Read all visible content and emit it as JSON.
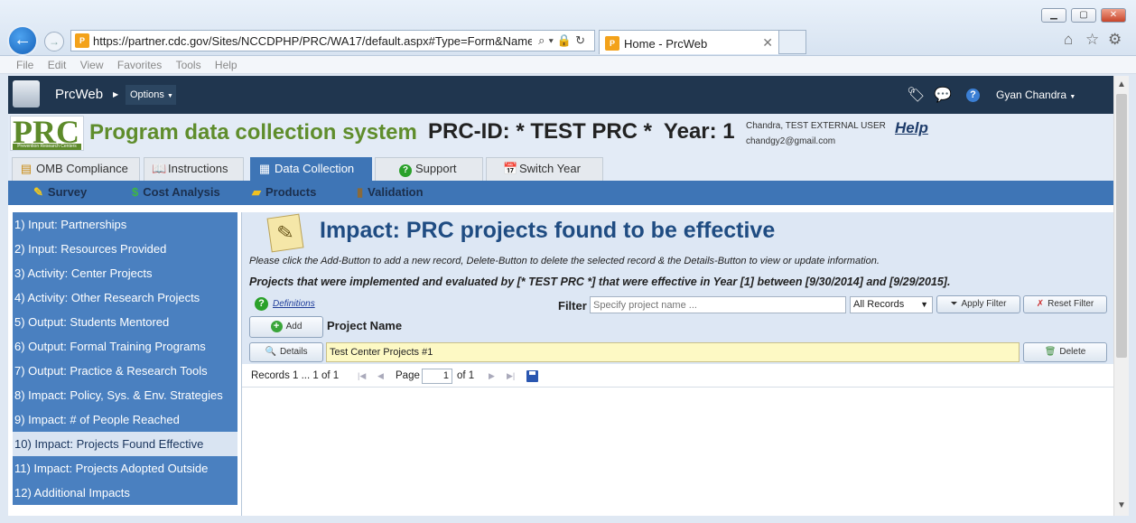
{
  "browser": {
    "url": "https://partner.cdc.gov/Sites/NCCDPHP/PRC/WA17/default.aspx#Type=Form&Name=fCyc",
    "tab_title": "Home - PrcWeb",
    "menu": [
      "File",
      "Edit",
      "View",
      "Favorites",
      "Tools",
      "Help"
    ]
  },
  "appbar": {
    "app_name": "PrcWeb",
    "options_label": "Options",
    "user_name": "Gyan Chandra"
  },
  "banner": {
    "logo_text": "PRC",
    "logo_tagline": "Prevention Research Centers",
    "system_title": "Program data collection system",
    "prc_id": "PRC-ID: * TEST PRC *  Year: 1",
    "user_line": "Chandra, TEST EXTERNAL USER",
    "user_email": "chandgy2@gmail.com",
    "help_label": "Help"
  },
  "main_tabs": [
    {
      "label": "OMB Compliance"
    },
    {
      "label": "Instructions"
    },
    {
      "label": "Data Collection"
    },
    {
      "label": "Support"
    },
    {
      "label": "Switch Year"
    }
  ],
  "sub_tabs": [
    {
      "label": "Survey"
    },
    {
      "label": "Cost Analysis"
    },
    {
      "label": "Products"
    },
    {
      "label": "Validation"
    }
  ],
  "sidenav": [
    {
      "label": "1) Input: Partnerships"
    },
    {
      "label": "2) Input: Resources Provided"
    },
    {
      "label": "3) Activity: Center Projects"
    },
    {
      "label": "4) Activity: Other Research Projects"
    },
    {
      "label": "5) Output: Students Mentored"
    },
    {
      "label": "6) Output: Formal Training Programs"
    },
    {
      "label": "7) Output: Practice & Research Tools"
    },
    {
      "label": "8) Impact: Policy, Sys. & Env. Strategies"
    },
    {
      "label": "9) Impact: # of People Reached"
    },
    {
      "label": "10) Impact: Projects Found Effective"
    },
    {
      "label": "11) Impact: Projects Adopted Outside"
    },
    {
      "label": "12) Additional Impacts"
    }
  ],
  "content": {
    "heading": "Impact: PRC projects found to be effective",
    "instructions": "Please click the Add-Button to add a new record, Delete-Button to delete the selected record & the Details-Button to view or update information.",
    "caption": "Projects that were implemented and evaluated by [* TEST PRC *] that were effective in Year [1] between [9/30/2014] and [9/29/2015].",
    "definitions_label": "Definitions",
    "filter_label": "Filter",
    "filter_placeholder": "Specify project name ...",
    "records_select": "All Records",
    "apply_filter_label": "Apply Filter",
    "reset_filter_label": "Reset Filter",
    "add_label": "Add",
    "column_header": "Project Name",
    "details_label": "Details",
    "delete_label": "Delete",
    "rows": [
      {
        "project_name": "Test Center Projects #1"
      }
    ],
    "pager": {
      "records_text": "Records 1 ... 1 of 1",
      "page_label": "Page",
      "page_value": "1",
      "of_text": "of 1"
    }
  },
  "colors": {
    "appbar_bg": "#20364f",
    "accent_blue": "#3e75b6",
    "title_green": "#5f8d2c",
    "selected_row": "#fdf9c4"
  }
}
